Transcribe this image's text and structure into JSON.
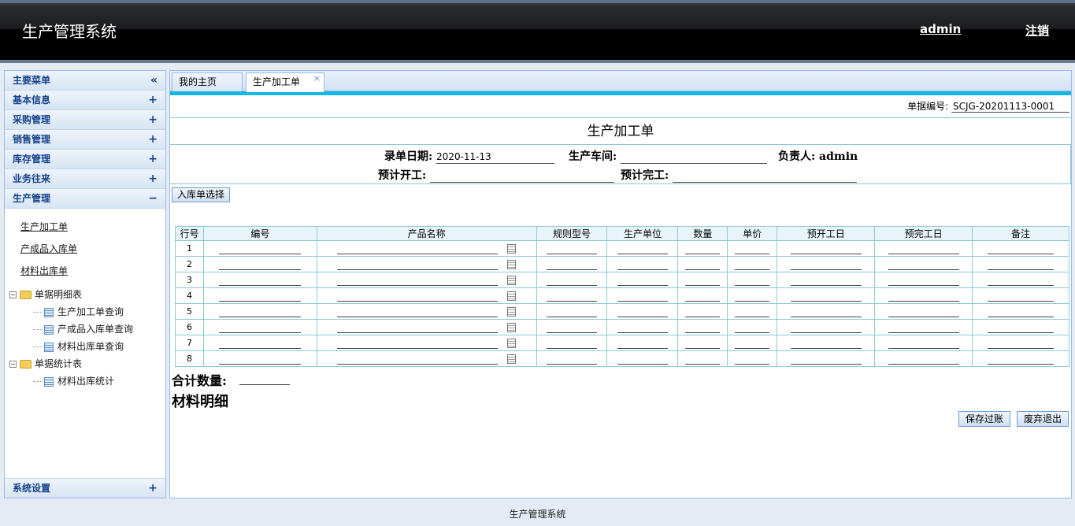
{
  "header": {
    "title": "生产管理系统",
    "user": "admin",
    "logout": "注销"
  },
  "sidebar": {
    "main_menu": "主要菜单",
    "collapse_icon": "«",
    "groups": [
      {
        "label": "基本信息",
        "sign": "+"
      },
      {
        "label": "采购管理",
        "sign": "+"
      },
      {
        "label": "销售管理",
        "sign": "+"
      },
      {
        "label": "库存管理",
        "sign": "+"
      },
      {
        "label": "业务往来",
        "sign": "+"
      },
      {
        "label": "生产管理",
        "sign": "−"
      }
    ],
    "links": [
      "生产加工单",
      "产成品入库单",
      "材料出库单"
    ],
    "tree": {
      "folder1": "单据明细表",
      "folder1_items": [
        "生产加工单查询",
        "产成品入库单查询",
        "材料出库单查询"
      ],
      "folder2": "单据统计表",
      "folder2_items": [
        "材料出库统计"
      ]
    },
    "settings": {
      "label": "系统设置",
      "sign": "+"
    }
  },
  "tabs": {
    "home": "我的主页",
    "current": "生产加工单",
    "close": "×"
  },
  "form": {
    "doc_no_label": "单据编号:",
    "doc_no": "SCJG-20201113-0001",
    "title": "生产加工单",
    "entry_date_label": "录单日期:",
    "entry_date": "2020-11-13",
    "workshop_label": "生产车间:",
    "owner_label": "负责人:",
    "owner": "admin",
    "plan_start_label": "预计开工:",
    "plan_end_label": "预计完工:",
    "pick_button": "入库单选择"
  },
  "grid": {
    "headers": [
      "行号",
      "编号",
      "产品名称",
      "规则型号",
      "生产单位",
      "数量",
      "单价",
      "预开工日",
      "预完工日",
      "备注"
    ],
    "rows": [
      "1",
      "2",
      "3",
      "4",
      "5",
      "6",
      "7",
      "8"
    ]
  },
  "summary": {
    "total_label": "合计数量:",
    "materials_label": "材料明细"
  },
  "actions": {
    "save": "保存过账",
    "discard": "废弃退出"
  },
  "footer": "生产管理系统"
}
